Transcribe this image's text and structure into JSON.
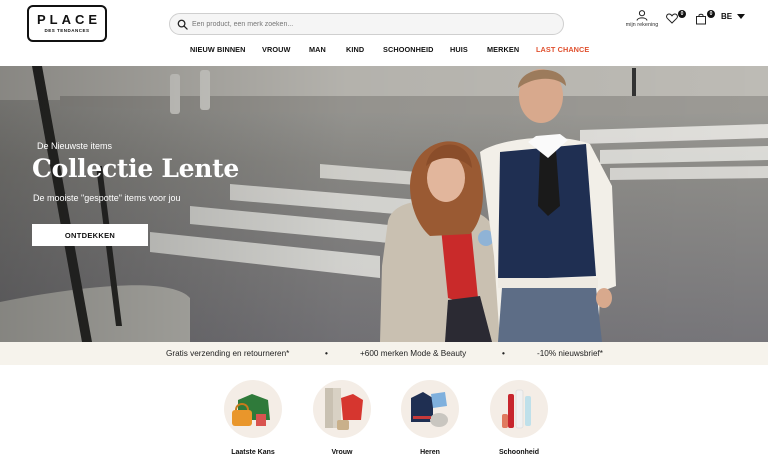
{
  "header": {
    "logo": {
      "main": "PLACE",
      "sub": "DES TENDANCES"
    },
    "search": {
      "placeholder": "Een product, een merk zoeken..."
    },
    "account_label": "mijn rekening",
    "wishlist_count": "0",
    "cart_count": "0",
    "language": "BE"
  },
  "nav": {
    "items": [
      "NIEUW BINNEN",
      "VROUW",
      "MAN",
      "KIND",
      "SCHOONHEID",
      "HUIS",
      "MERKEN",
      "LAST CHANCE"
    ],
    "sale_color": "#e0502e"
  },
  "hero": {
    "kicker": "De Nieuwste items",
    "title": "Collectie Lente",
    "subtitle": "De mooiste \"gespotte\" items voor jou",
    "cta": "ONTDEKKEN"
  },
  "usp": {
    "items": [
      "Gratis verzending en retourneren*",
      "+600 merken Mode & Beauty",
      "-10% nieuwsbrief*"
    ],
    "separator": "•"
  },
  "categories": [
    {
      "label": "Laatste Kans"
    },
    {
      "label": "Vrouw"
    },
    {
      "label": "Heren"
    },
    {
      "label": "Schoonheid"
    }
  ],
  "colors": {
    "accent": "#e0502e",
    "usp_background": "#f6f3ec",
    "category_circle": "#f4ede6"
  }
}
